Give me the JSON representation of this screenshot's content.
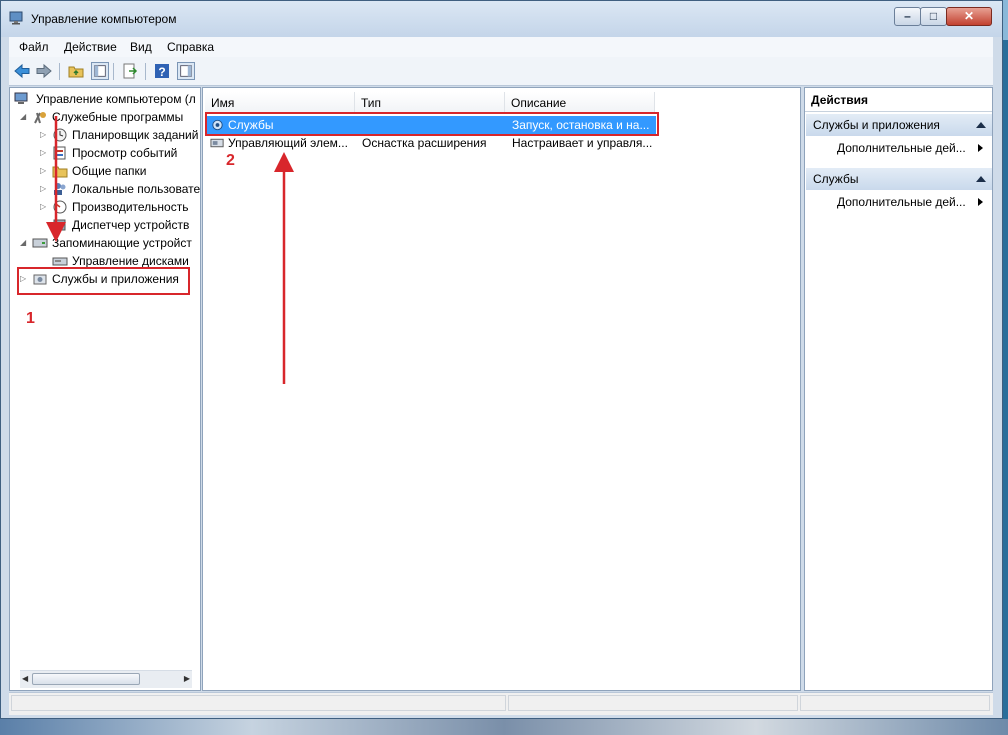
{
  "window": {
    "title": "Управление компьютером"
  },
  "menu": [
    "Файл",
    "Действие",
    "Вид",
    "Справка"
  ],
  "tree": {
    "root": "Управление компьютером (л",
    "utilities": "Служебные программы",
    "scheduler": "Планировщик заданий",
    "events": "Просмотр событий",
    "shared": "Общие папки",
    "local_users": "Локальные пользовате",
    "performance": "Производительность",
    "device_manager": "Диспетчер устройств",
    "storage": "Запоминающие устройст",
    "disk_management": "Управление дисками",
    "services_apps": "Службы и приложения"
  },
  "list": {
    "columns": {
      "name": "Имя",
      "type": "Тип",
      "description": "Описание"
    },
    "rows": [
      {
        "name": "Службы",
        "type": "",
        "description": "Запуск, остановка и на..."
      },
      {
        "name": "Управляющий элем...",
        "type": "Оснастка расширения",
        "description": "Настраивает и управля..."
      }
    ]
  },
  "actions": {
    "title": "Действия",
    "group1": "Службы и приложения",
    "group1_more": "Дополнительные дей...",
    "group2": "Службы",
    "group2_more": "Дополнительные дей..."
  },
  "annotations": {
    "one": "1",
    "two": "2"
  },
  "colors": {
    "selection": "#3399ff",
    "annotation": "#d8262b"
  }
}
